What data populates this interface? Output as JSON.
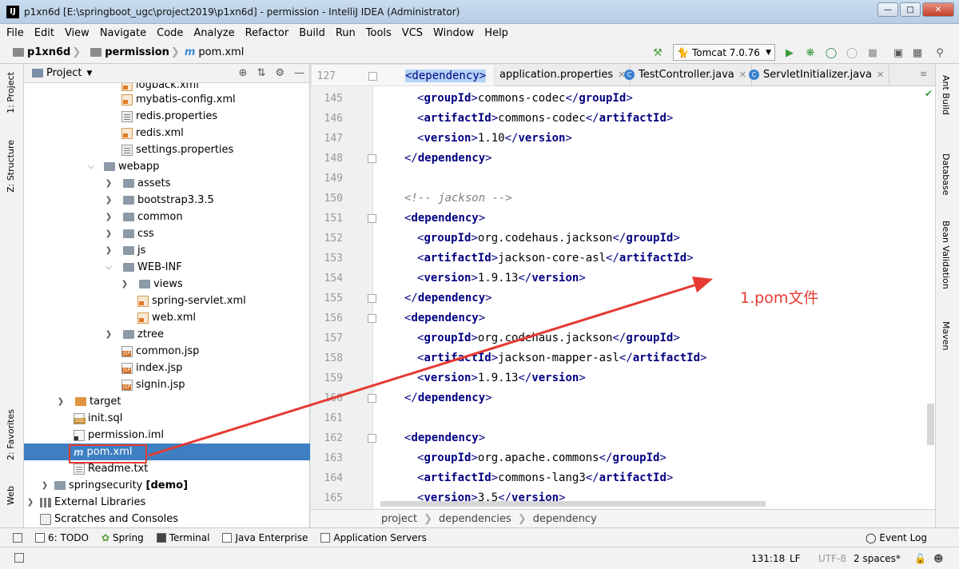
{
  "window": {
    "title": "p1xn6d [E:\\springboot_ugc\\project2019\\p1xn6d] - permission - IntelliJ IDEA (Administrator)",
    "app_icon": "IJ"
  },
  "menu": [
    "File",
    "Edit",
    "View",
    "Navigate",
    "Code",
    "Analyze",
    "Refactor",
    "Build",
    "Run",
    "Tools",
    "VCS",
    "Window",
    "Help"
  ],
  "navbar": {
    "crumbs": [
      "p1xn6d",
      "permission",
      "pom.xml"
    ],
    "run_config": "Tomcat 7.0.76"
  },
  "left_tool_tabs": [
    "1: Project",
    "Z: Structure",
    "2: Favorites",
    "Web"
  ],
  "right_tool_tabs": [
    "Ant Build",
    "Database",
    "Bean Validation",
    "Maven"
  ],
  "project_panel": {
    "title": "Project",
    "tree": [
      {
        "label": "logback.xml",
        "icon": "xml-file-icon"
      },
      {
        "label": "mybatis-config.xml",
        "icon": "xml-file-icon"
      },
      {
        "label": "redis.properties",
        "icon": "properties-file-icon"
      },
      {
        "label": "redis.xml",
        "icon": "xml-file-icon"
      },
      {
        "label": "settings.properties",
        "icon": "properties-file-icon"
      },
      {
        "label": "webapp",
        "icon": "folder-icon"
      },
      {
        "label": "assets",
        "icon": "folder-icon"
      },
      {
        "label": "bootstrap3.3.5",
        "icon": "folder-icon"
      },
      {
        "label": "common",
        "icon": "folder-icon"
      },
      {
        "label": "css",
        "icon": "folder-icon"
      },
      {
        "label": "js",
        "icon": "folder-icon"
      },
      {
        "label": "WEB-INF",
        "icon": "folder-icon"
      },
      {
        "label": "views",
        "icon": "folder-icon"
      },
      {
        "label": "spring-servlet.xml",
        "icon": "xml-file-icon"
      },
      {
        "label": "web.xml",
        "icon": "xml-file-icon"
      },
      {
        "label": "ztree",
        "icon": "folder-icon"
      },
      {
        "label": "common.jsp",
        "icon": "jsp-file-icon"
      },
      {
        "label": "index.jsp",
        "icon": "jsp-file-icon"
      },
      {
        "label": "signin.jsp",
        "icon": "jsp-file-icon"
      },
      {
        "label": "target",
        "icon": "folder-icon"
      },
      {
        "label": "init.sql",
        "icon": "sql-file-icon"
      },
      {
        "label": "permission.iml",
        "icon": "iml-file-icon"
      },
      {
        "label": "pom.xml",
        "icon": "maven-file-icon"
      },
      {
        "label": "Readme.txt",
        "icon": "text-file-icon"
      },
      {
        "label": "springsecurity",
        "suffix": "[demo]",
        "icon": "folder-icon"
      },
      {
        "label": "External Libraries",
        "icon": "library-icon"
      },
      {
        "label": "Scratches and Consoles",
        "icon": "scratch-icon"
      }
    ]
  },
  "editor": {
    "tabs": [
      "<dependency>",
      "application.properties",
      "TestController.java",
      "ServletInitializer.java"
    ],
    "sticky_line": "127",
    "lines": [
      {
        "n": "145",
        "code": "<groupId>commons-codec</groupId>"
      },
      {
        "n": "146",
        "code": "<artifactId>commons-codec</artifactId>"
      },
      {
        "n": "147",
        "code": "<version>1.10</version>"
      },
      {
        "n": "148",
        "code": "</dependency>"
      },
      {
        "n": "149",
        "code": ""
      },
      {
        "n": "150",
        "code": "<!-- jackson -->"
      },
      {
        "n": "151",
        "code": "<dependency>"
      },
      {
        "n": "152",
        "code": "<groupId>org.codehaus.jackson</groupId>"
      },
      {
        "n": "153",
        "code": "<artifactId>jackson-core-asl</artifactId>"
      },
      {
        "n": "154",
        "code": "<version>1.9.13</version>"
      },
      {
        "n": "155",
        "code": "</dependency>"
      },
      {
        "n": "156",
        "code": "<dependency>"
      },
      {
        "n": "157",
        "code": "<groupId>org.codehaus.jackson</groupId>"
      },
      {
        "n": "158",
        "code": "<artifactId>jackson-mapper-asl</artifactId>"
      },
      {
        "n": "159",
        "code": "<version>1.9.13</version>"
      },
      {
        "n": "160",
        "code": "</dependency>"
      },
      {
        "n": "161",
        "code": ""
      },
      {
        "n": "162",
        "code": "<dependency>"
      },
      {
        "n": "163",
        "code": "<groupId>org.apache.commons</groupId>"
      },
      {
        "n": "164",
        "code": "<artifactId>commons-lang3</artifactId>"
      },
      {
        "n": "165",
        "code": "<version>3.5</version>"
      }
    ],
    "breadcrumb": [
      "project",
      "dependencies",
      "dependency"
    ]
  },
  "annotation": "1.pom文件",
  "annotation_color": "#e63a33",
  "tool_windows": [
    "6: TODO",
    "Spring",
    "Terminal",
    "Java Enterprise",
    "Application Servers"
  ],
  "event_log": "Event Log",
  "status": {
    "position": "131:18",
    "line_sep": "LF",
    "encoding": "UTF-8",
    "indent": "2 spaces*"
  }
}
